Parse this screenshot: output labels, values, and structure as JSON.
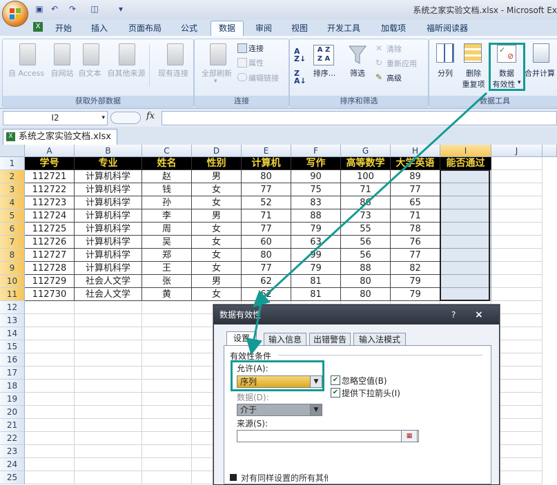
{
  "window": {
    "doc_title": "系统之家实验文档.xlsx - Microsoft Ex"
  },
  "tabs": [
    "开始",
    "插入",
    "页面布局",
    "公式",
    "数据",
    "审阅",
    "视图",
    "开发工具",
    "加载项",
    "福昕阅读器"
  ],
  "active_tab": "数据",
  "ribbon": {
    "get_external": {
      "label": "获取外部数据",
      "buttons": [
        "自 Access",
        "自网站",
        "自文本",
        "自其他来源",
        "现有连接"
      ]
    },
    "connections": {
      "label": "连接",
      "refresh_all": "全部刷新",
      "connect": "连接",
      "properties": "属性",
      "edit_links": "编辑链接"
    },
    "sort_filter": {
      "label": "排序和筛选",
      "sort": "排序...",
      "filter": "筛选",
      "clear": "清除",
      "reapply": "重新应用",
      "advanced": "高级"
    },
    "data_tools": {
      "label": "数据工具",
      "split": "分列",
      "remove_dup_1": "删除",
      "remove_dup_2": "重复项",
      "validation_1": "数据",
      "validation_2": "有效性",
      "consolidate": "合并计算"
    }
  },
  "formula_bar": {
    "name_box": "I2",
    "fx": "fx",
    "formula": ""
  },
  "workbook_tab": "系统之家实验文档.xlsx",
  "sheet": {
    "columns": [
      "A",
      "B",
      "C",
      "D",
      "E",
      "F",
      "G",
      "H",
      "I",
      "J"
    ],
    "row_numbers": [
      "1",
      "2",
      "3",
      "4",
      "5",
      "6",
      "7",
      "8",
      "9",
      "10",
      "11",
      "12",
      "13",
      "14",
      "15",
      "16",
      "17",
      "18",
      "19",
      "20",
      "21",
      "22",
      "23",
      "24",
      "25"
    ],
    "header": [
      "学号",
      "专业",
      "姓名",
      "性别",
      "计算机",
      "写作",
      "高等数学",
      "大学英语",
      "能否通过"
    ],
    "rows": [
      [
        "112721",
        "计算机科学",
        "赵",
        "男",
        "80",
        "90",
        "100",
        "89",
        ""
      ],
      [
        "112722",
        "计算机科学",
        "钱",
        "女",
        "77",
        "75",
        "71",
        "77",
        ""
      ],
      [
        "112723",
        "计算机科学",
        "孙",
        "女",
        "52",
        "83",
        "86",
        "65",
        ""
      ],
      [
        "112724",
        "计算机科学",
        "李",
        "男",
        "71",
        "88",
        "73",
        "71",
        ""
      ],
      [
        "112725",
        "计算机科学",
        "周",
        "女",
        "77",
        "79",
        "55",
        "78",
        ""
      ],
      [
        "112726",
        "计算机科学",
        "吴",
        "女",
        "60",
        "63",
        "56",
        "76",
        ""
      ],
      [
        "112727",
        "计算机科学",
        "郑",
        "女",
        "80",
        "99",
        "56",
        "77",
        ""
      ],
      [
        "112728",
        "计算机科学",
        "王",
        "女",
        "77",
        "79",
        "88",
        "82",
        ""
      ],
      [
        "112729",
        "社会人文学",
        "张",
        "男",
        "62",
        "81",
        "80",
        "79",
        ""
      ],
      [
        "112730",
        "社会人文学",
        "黄",
        "女",
        "62",
        "81",
        "80",
        "79",
        ""
      ]
    ]
  },
  "dialog": {
    "title": "数据有效性",
    "help": "?",
    "close": "×",
    "tabs": [
      "设置",
      "输入信息",
      "出错警告",
      "输入法模式"
    ],
    "criteria_label": "有效性条件",
    "allow_label": "允许(A):",
    "allow_value": "序列",
    "ignore_blank": "忽略空值(B)",
    "dropdown": "提供下拉箭头(I)",
    "data_label": "数据(D):",
    "data_value": "介于",
    "source_label": "来源(S):",
    "source_value": "",
    "apply_all": "对有同样设置的所有其他单元格应用这些更改(P)"
  },
  "colors": {
    "accent_teal": "#139a94",
    "header_bg": "#000000",
    "header_text": "#f4d43b"
  }
}
